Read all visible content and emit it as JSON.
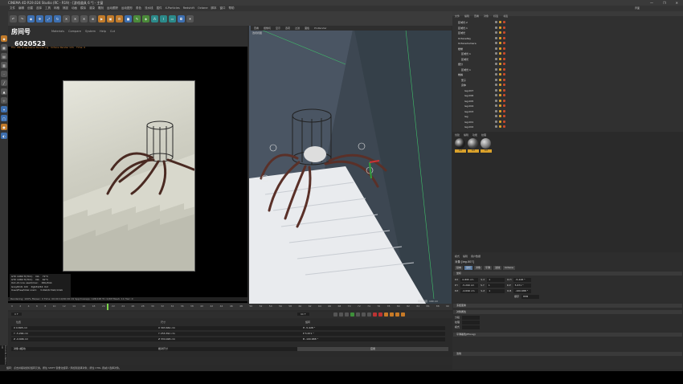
{
  "window": {
    "title": "CINEMA 4D R19.024 Studio (RC - R19) - [游戏道具 6 *] - 主窗",
    "buttons": [
      "—",
      "❐",
      "✕"
    ]
  },
  "menubar": [
    "文件",
    "编辑",
    "创建",
    "选择",
    "工具",
    "网格",
    "捕捉",
    "动画",
    "模拟",
    "渲染",
    "雕刻",
    "运动跟踪",
    "运动图形",
    "角色",
    "流水线",
    "插件",
    "X-Particles",
    "Redshift",
    "Octane",
    "脚本",
    "窗口",
    "帮助"
  ],
  "layout_label": "界面",
  "watermark": {
    "text": "房间号",
    "number": "6020523"
  },
  "left_viewport": {
    "menu": [
      "Materials",
      "Compare",
      "System",
      "Help",
      "Cut"
    ],
    "info": "File: IPR Progressive Rendering · Octane Render Info · Time: 0"
  },
  "stats": [
    [
      "GTX 1080 Ti(TCC)",
      "NA",
      "72°C"
    ],
    [
      "GTX 1080 Ti(TCC)",
      "NA",
      "62°C"
    ],
    [
      "Out-of-core used/max:",
      "0Kb/4Gb",
      ""
    ],
    [
      "Grey8/16: 0/0",
      "Rgb32/64: 0/2",
      ""
    ],
    [
      "Used/free/total vram:",
      "3.9Gb/6.5Gb/11Gb",
      ""
    ]
  ],
  "render_status": "Rendering: 100%   Ms/sec: 0   Time: 00:00:19/00:00:19   Spp/maxspp: 128/128   Tri: 0/2M   Mesh: 11   Hair: 0",
  "right_viewport": {
    "menu": [
      "查看",
      "摄像机",
      "显示",
      "选项",
      "过滤",
      "面板",
      "ProRender"
    ],
    "label": "透视视图",
    "coords": "网格间距: 100 cm"
  },
  "timeline": {
    "ticks": [
      "0",
      "2",
      "4",
      "6",
      "8",
      "10",
      "12",
      "14",
      "16",
      "18",
      "20",
      "22",
      "24",
      "26",
      "28",
      "30",
      "32",
      "34",
      "36",
      "38",
      "40",
      "42",
      "44",
      "46",
      "48",
      "50",
      "52",
      "54",
      "56",
      "58",
      "60",
      "62",
      "64",
      "66",
      "68",
      "70",
      "72",
      "74",
      "76",
      "78",
      "80",
      "82",
      "84",
      "86",
      "88",
      "90"
    ],
    "current_frame": "0 F",
    "end_frame": "90 F"
  },
  "coords": {
    "headers": [
      "位置",
      "尺寸",
      "旋转"
    ],
    "position": [
      "X  0.895 cm",
      "Y  -5.299 cm",
      "Z  -0.696 cm"
    ],
    "size": [
      "X  393.661 cm",
      "Y  253.391 cm",
      "Z  334.926 cm"
    ],
    "rotation": [
      "H  -5.428 °",
      "P  5.671 °",
      "B  -100.688 °"
    ],
    "mode_obj": "对象 (相对)",
    "mode_size": "绝对尺寸",
    "apply": "应用"
  },
  "status_text": "旋转：点击并拖动鼠标旋转元素。按住 SHIFT 键量化旋转 / 添加到选择对象；按住 CTRL 键减少选择对象。",
  "object_manager": {
    "menu": [
      "文件",
      "编辑",
      "查看",
      "对象",
      "标签",
      "书签"
    ],
    "rows": [
      {
        "name": "区域光.2",
        "indent": 0
      },
      {
        "name": "区域光.1",
        "indent": 0
      },
      {
        "name": "区域光",
        "indent": 0
      },
      {
        "name": "OctaneSky",
        "indent": 0
      },
      {
        "name": "OctaneCamera",
        "indent": 0
      },
      {
        "name": "楼梯",
        "indent": 0
      },
      {
        "name": "区域光.1",
        "indent": 1
      },
      {
        "name": "区域光",
        "indent": 1
      },
      {
        "name": "细分",
        "indent": 0
      },
      {
        "name": "区域光.1",
        "indent": 1
      },
      {
        "name": "蜘蛛",
        "indent": 0
      },
      {
        "name": "笼子",
        "indent": 1
      },
      {
        "name": "身体",
        "indent": 1
      },
      {
        "name": "leg.007",
        "indent": 2
      },
      {
        "name": "leg.006",
        "indent": 2
      },
      {
        "name": "leg.005",
        "indent": 2
      },
      {
        "name": "leg.004",
        "indent": 2
      },
      {
        "name": "leg.003",
        "indent": 2
      },
      {
        "name": "leg",
        "indent": 2
      },
      {
        "name": "leg.001",
        "indent": 2
      },
      {
        "name": "leg.002",
        "indent": 2
      }
    ]
  },
  "material_manager": {
    "menu": [
      "创建",
      "编辑",
      "功能",
      "纹理"
    ],
    "materials": [
      {
        "label": "Oct",
        "color": "#222222"
      },
      {
        "label": "Oct",
        "color": "#4a4a4a"
      },
      {
        "label": "Oct",
        "color": "#7a7a7a"
      }
    ]
  },
  "attribute_manager": {
    "menu": [
      "模式",
      "编辑",
      "用户数据"
    ],
    "title": "对象 [leg.007]",
    "tabs": [
      "基本",
      "坐标",
      "对象",
      "平滑",
      "法线",
      "Octane"
    ],
    "section_coords": "坐标",
    "params": [
      [
        "P.X",
        "0.895 cm",
        "S.X",
        "1",
        "R.H",
        "-5.428 °"
      ],
      [
        "P.Y",
        "-5.299 cm",
        "S.Y",
        "1",
        "R.P",
        "5.671 °"
      ],
      [
        "P.Z",
        "-0.696 cm",
        "S.Z",
        "1",
        "R.B",
        "-100.688 °"
      ]
    ],
    "order_label": "顺序",
    "order_value": "HPB",
    "section_freeze": "冻结变换",
    "section_object": "对象属性",
    "section_smooth": "平滑着色(Phong)",
    "section_normal": "法线",
    "object_fields": [
      "分段",
      "纹理",
      "模式"
    ]
  },
  "accent_colors": {
    "playhead": "#7ad34a",
    "highlight": "#d9a12b",
    "selected": "#5a7aa0"
  }
}
